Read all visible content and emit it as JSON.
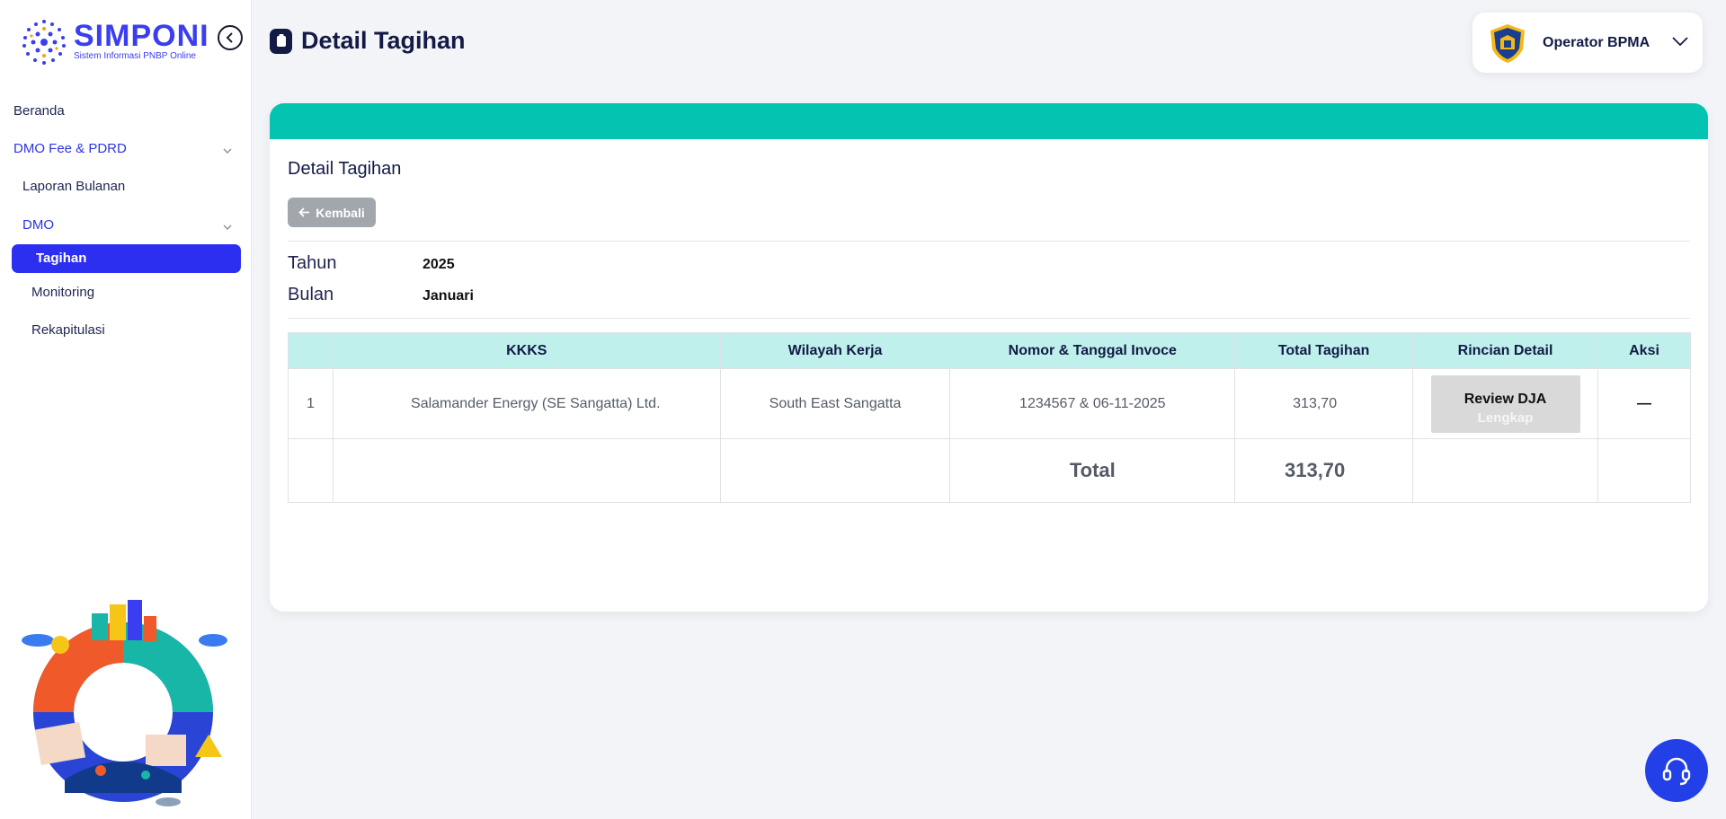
{
  "brand": {
    "title": "SIMPONI",
    "subtitle": "Sistem Informasi PNBP Online",
    "primary_color": "#2d2ff0",
    "accent_color": "#03c4b0"
  },
  "sidebar": {
    "items": [
      {
        "label": "Beranda"
      },
      {
        "label": "DMO Fee & PDRD"
      },
      {
        "label": "Laporan Bulanan"
      },
      {
        "label": "DMO"
      },
      {
        "label": "Tagihan",
        "active": true
      },
      {
        "label": "Monitoring"
      },
      {
        "label": "Rekapitulasi"
      }
    ]
  },
  "header": {
    "title": "Detail Tagihan",
    "user": "Operator BPMA"
  },
  "card": {
    "title": "Detail Tagihan",
    "back_label": "Kembali",
    "tahun_label": "Tahun",
    "tahun_value": "2025",
    "bulan_label": "Bulan",
    "bulan_value": "Januari"
  },
  "table": {
    "headers": [
      "",
      "KKKS",
      "Wilayah Kerja",
      "Nomor & Tanggal Invoce",
      "Total Tagihan",
      "Rincian Detail",
      "Aksi"
    ],
    "rows": [
      {
        "no": "1",
        "kkks": "Salamander Energy (SE Sangatta) Ltd.",
        "wilayah": "South East Sangatta",
        "invoice": "1234567 & 06-11-2025",
        "total": "313,70",
        "rincian_main": "Review DJA",
        "rincian_sub": "Lengkap",
        "aksi": "—"
      }
    ],
    "total_label": "Total",
    "total_value": "313,70"
  },
  "icons": [
    "chevron-left-circle-icon",
    "clipboard-icon",
    "chevron-down-icon",
    "arrow-left-icon",
    "first-page-icon",
    "prev-page-icon",
    "next-page-icon",
    "last-page-icon",
    "headset-icon"
  ]
}
